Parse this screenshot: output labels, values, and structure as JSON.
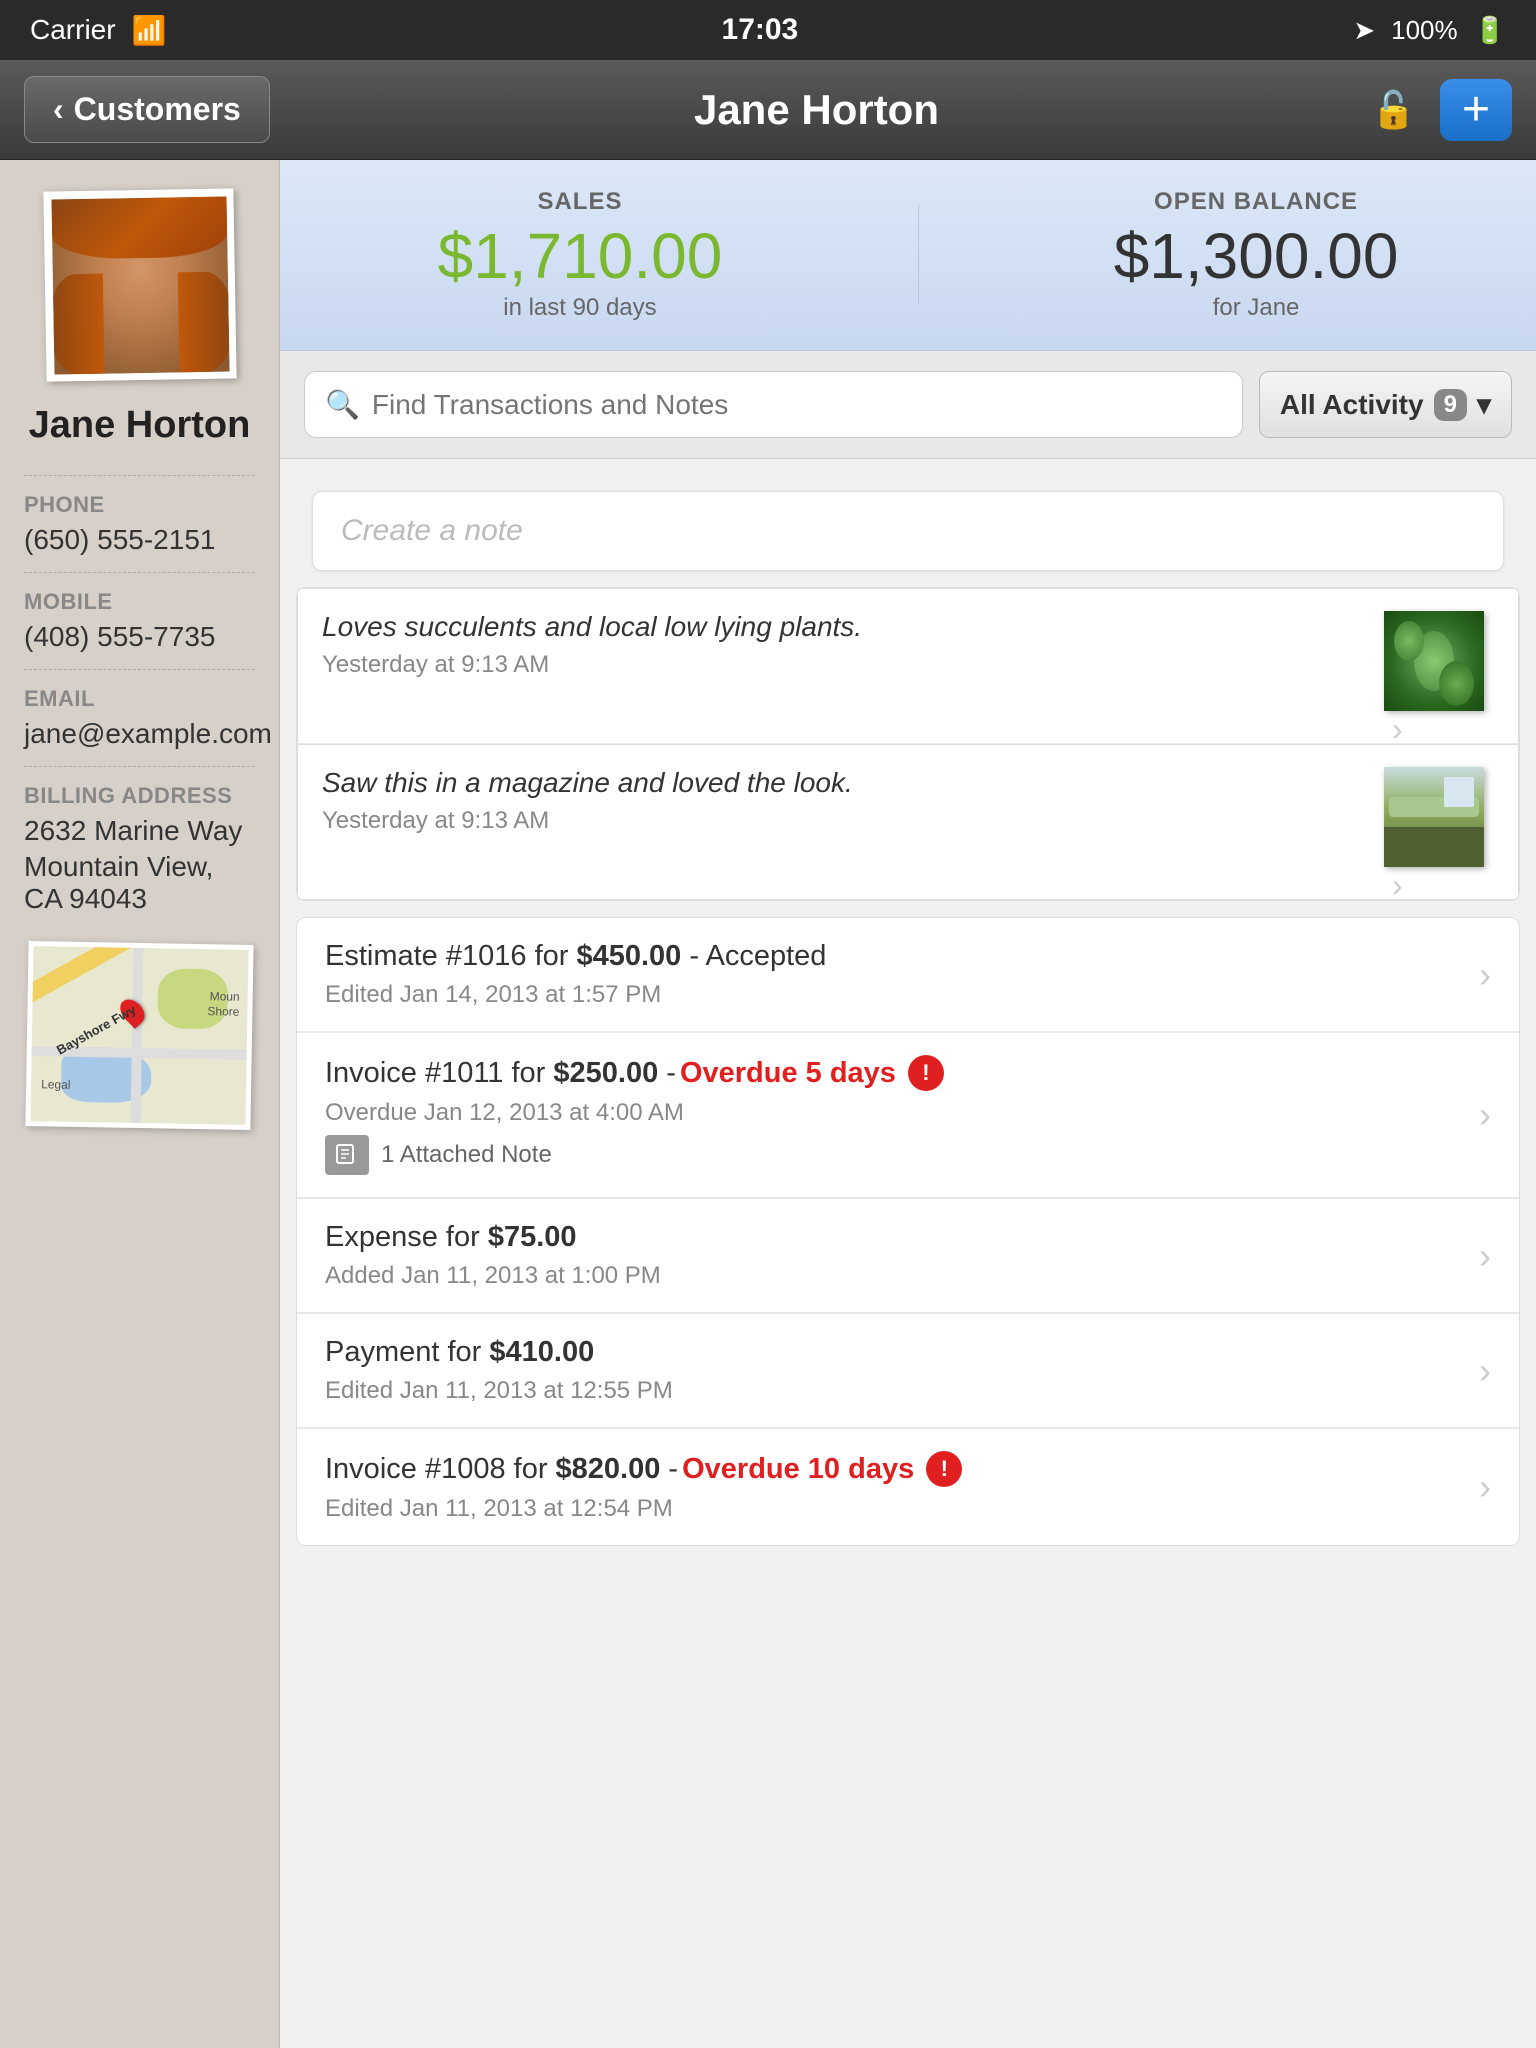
{
  "statusBar": {
    "carrier": "Carrier",
    "wifi": "WiFi",
    "time": "17:03",
    "battery": "100%"
  },
  "navBar": {
    "backLabel": "Customers",
    "title": "Jane Horton",
    "addIcon": "+"
  },
  "stats": {
    "salesLabel": "SALES",
    "salesAmount": "$1,710.00",
    "salesSub": "in last 90 days",
    "balanceLabel": "OPEN BALANCE",
    "balanceAmount": "$1,300.00",
    "balanceSub": "for Jane"
  },
  "search": {
    "placeholder": "Find Transactions and Notes",
    "activityLabel": "All Activity",
    "activityCount": "9"
  },
  "createNote": {
    "placeholder": "Create a note"
  },
  "notes": [
    {
      "text": "Loves succulents and local low lying plants.",
      "time": "Yesterday at 9:13 AM",
      "hasImage": true,
      "imageType": "succulent"
    },
    {
      "text": "Saw this in a magazine and loved the look.",
      "time": "Yesterday at 9:13 AM",
      "hasImage": true,
      "imageType": "garden"
    }
  ],
  "transactions": [
    {
      "type": "estimate",
      "title": "Estimate #1016 for ",
      "amount": "$450.00",
      "suffix": " - Accepted",
      "date": "Edited Jan 14, 2013 at 1:57 PM",
      "overdue": false,
      "overdueText": "",
      "hasNote": false,
      "noteCount": ""
    },
    {
      "type": "invoice",
      "title": "Invoice #1011 for ",
      "amount": "$250.00",
      "suffix": " - ",
      "date": "Overdue Jan 12, 2013 at 4:00 AM",
      "overdue": true,
      "overdueText": "Overdue 5 days",
      "hasNote": true,
      "noteCount": "1 Attached Note"
    },
    {
      "type": "expense",
      "title": "Expense for ",
      "amount": "$75.00",
      "suffix": "",
      "date": "Added Jan 11, 2013 at 1:00 PM",
      "overdue": false,
      "overdueText": "",
      "hasNote": false,
      "noteCount": ""
    },
    {
      "type": "payment",
      "title": "Payment for ",
      "amount": "$410.00",
      "suffix": "",
      "date": "Edited Jan 11, 2013 at 12:55 PM",
      "overdue": false,
      "overdueText": "",
      "hasNote": false,
      "noteCount": ""
    },
    {
      "type": "invoice",
      "title": "Invoice #1008 for ",
      "amount": "$820.00",
      "suffix": " - ",
      "date": "Edited Jan 11, 2013 at 12:54 PM",
      "overdue": true,
      "overdueText": "Overdue 10 days",
      "hasNote": false,
      "noteCount": ""
    }
  ],
  "contact": {
    "phoneLabel": "PHONE",
    "phone": "(650) 555-2151",
    "mobileLabel": "MOBILE",
    "mobile": "(408) 555-7735",
    "emailLabel": "EMAIL",
    "email": "jane@example.com",
    "addressLabel": "BILLING ADDRESS",
    "address1": "2632 Marine Way",
    "address2": "Mountain View, CA 94043"
  }
}
